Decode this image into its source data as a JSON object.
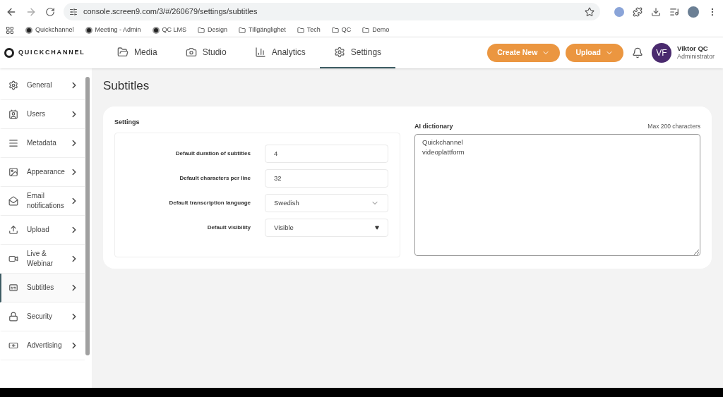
{
  "browser": {
    "url": "console.screen9.com/3/#/260679/settings/subtitles",
    "bookmarks": [
      {
        "kind": "site",
        "label": "Quickchannel"
      },
      {
        "kind": "site",
        "label": "Meeting - Admin"
      },
      {
        "kind": "site",
        "label": "QC LMS"
      },
      {
        "kind": "folder",
        "label": "Design"
      },
      {
        "kind": "folder",
        "label": "Tillgänglighet"
      },
      {
        "kind": "folder",
        "label": "Tech"
      },
      {
        "kind": "folder",
        "label": "QC"
      },
      {
        "kind": "folder",
        "label": "Demo"
      }
    ]
  },
  "header": {
    "logo": "QUICKCHANNEL",
    "tabs": [
      {
        "label": "Media",
        "selected": false
      },
      {
        "label": "Studio",
        "selected": false
      },
      {
        "label": "Analytics",
        "selected": false
      },
      {
        "label": "Settings",
        "selected": true
      }
    ],
    "buttons": [
      "Create New",
      "Upload"
    ],
    "user": {
      "initials": "VF",
      "name": "Viktor QC",
      "role": "Administrator"
    }
  },
  "sidebar": {
    "items": [
      {
        "label": "General",
        "selected": false
      },
      {
        "label": "Users",
        "selected": false
      },
      {
        "label": "Metadata",
        "selected": false
      },
      {
        "label": "Appearance",
        "selected": false
      },
      {
        "label": "Email notifications",
        "selected": false
      },
      {
        "label": "Upload",
        "selected": false
      },
      {
        "label": "Live & Webinar",
        "selected": false
      },
      {
        "label": "Subtitles",
        "selected": true
      },
      {
        "label": "Security",
        "selected": false
      },
      {
        "label": "Advertising",
        "selected": false
      }
    ]
  },
  "page": {
    "title": "Subtitles",
    "settings": {
      "title": "Settings",
      "fields": [
        {
          "kind": "text",
          "label": "Default duration of subtitles",
          "value": "4"
        },
        {
          "kind": "text",
          "label": "Default characters per line",
          "value": "32"
        },
        {
          "kind": "select",
          "label": "Default transcription language",
          "value": "Swedish"
        },
        {
          "kind": "native-select",
          "label": "Default visibility",
          "value": "Visible"
        }
      ]
    },
    "dictionary": {
      "title": "AI dictionary",
      "hint": "Max 200 characters",
      "value": "Quickchannel\nvideoplattform"
    }
  }
}
